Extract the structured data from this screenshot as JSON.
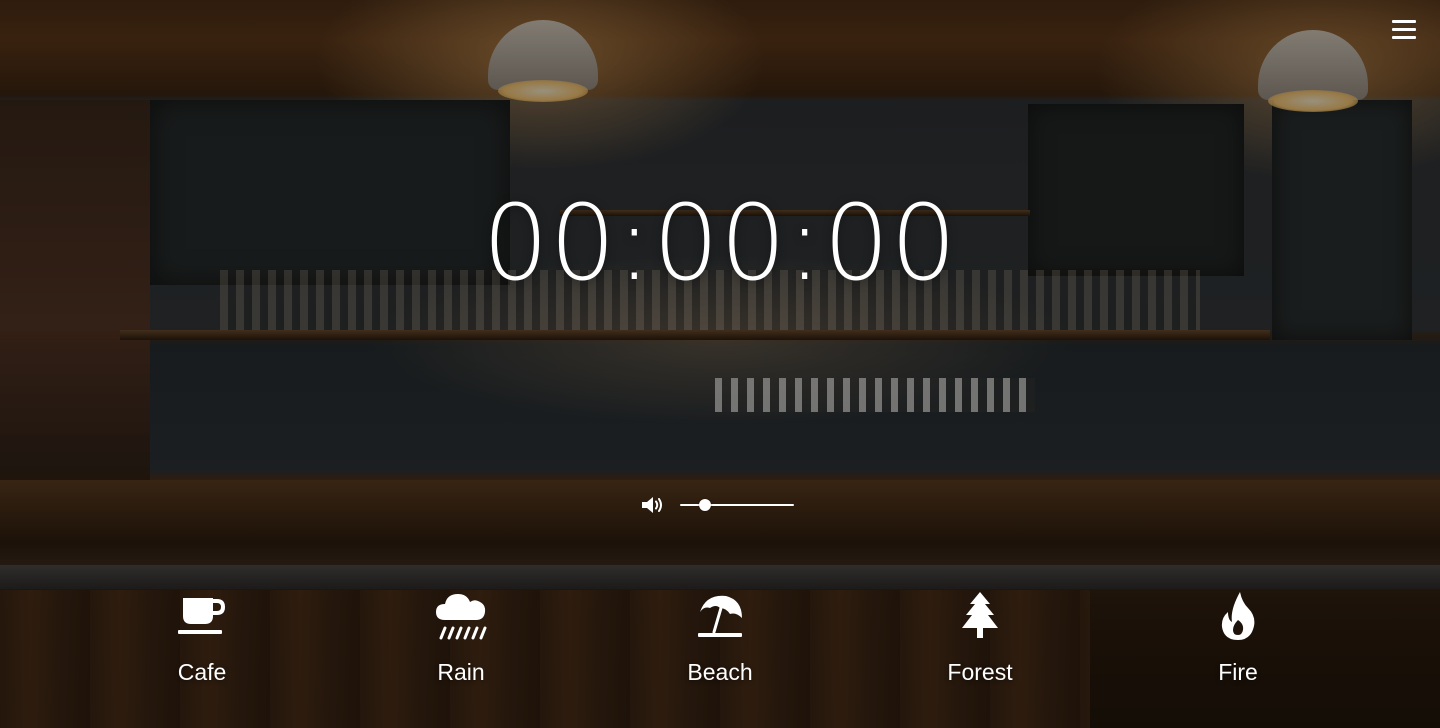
{
  "timer": {
    "display": "00:00:00"
  },
  "volume": {
    "level": 0.22
  },
  "sounds": [
    {
      "id": "cafe",
      "label": "Cafe",
      "icon": "coffee-cup-icon"
    },
    {
      "id": "rain",
      "label": "Rain",
      "icon": "rain-cloud-icon"
    },
    {
      "id": "beach",
      "label": "Beach",
      "icon": "beach-umbrella-icon"
    },
    {
      "id": "forest",
      "label": "Forest",
      "icon": "pine-tree-icon"
    },
    {
      "id": "fire",
      "label": "Fire",
      "icon": "flame-icon"
    }
  ],
  "menu": {
    "icon": "hamburger-menu-icon"
  },
  "colors": {
    "foreground": "#ffffff"
  }
}
